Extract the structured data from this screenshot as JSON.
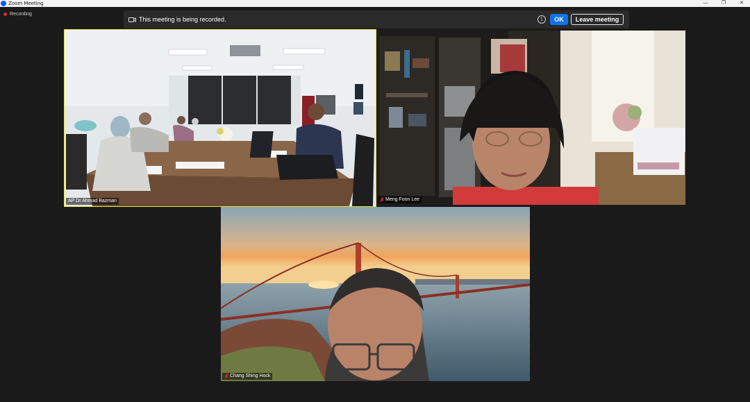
{
  "window": {
    "title": "Zoom Meeting",
    "controls": [
      "minimize",
      "restore",
      "close"
    ]
  },
  "recording_indicator": {
    "label": "Recording"
  },
  "banner": {
    "message": "This meeting is being recorded.",
    "ok_label": "OK",
    "leave_label": "Leave meeting",
    "info_glyph": "i"
  },
  "participants": [
    {
      "name": "AP Dr Ahmad Bazman",
      "muted": false,
      "active_speaker": true
    },
    {
      "name": "Meng Foon Lee",
      "muted": true,
      "active_speaker": false
    },
    {
      "name": "Chang Shing Hock",
      "muted": true,
      "active_speaker": false
    }
  ],
  "colors": {
    "background": "#1a1a1a",
    "ok_button": "#0e72ed",
    "active_speaker_border": "#e9e23a",
    "recording_dot": "#e02828",
    "muted_icon": "#e02828"
  },
  "icons": {
    "banner": "video-camera-icon",
    "info": "info-icon",
    "muted": "mic-muted-icon",
    "unmuted": "mic-icon"
  }
}
